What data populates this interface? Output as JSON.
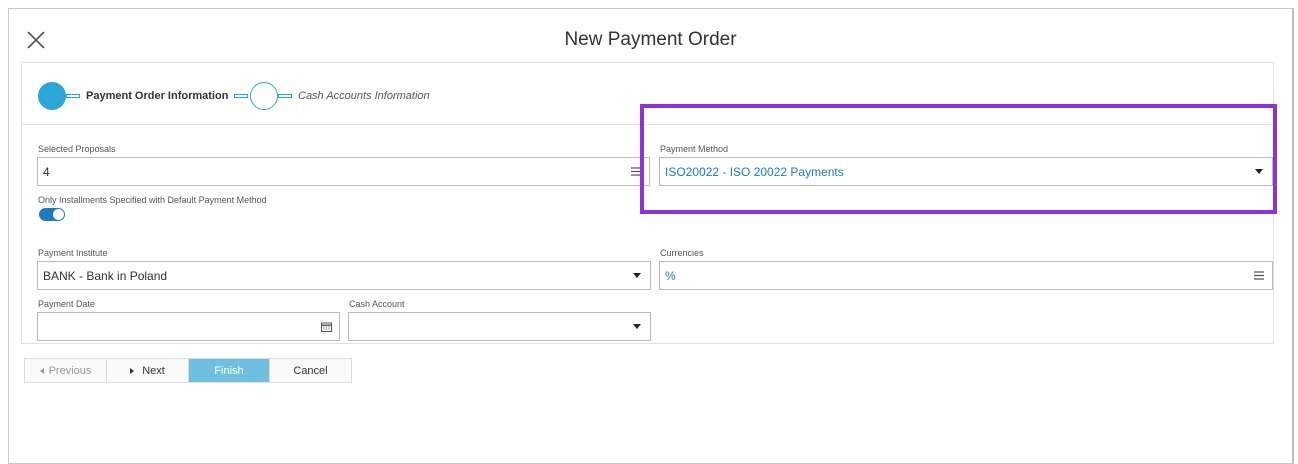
{
  "dialog": {
    "title": "New Payment Order"
  },
  "wizard": {
    "steps": [
      {
        "label": "Payment Order Information",
        "active": true
      },
      {
        "label": "Cash Accounts Information",
        "active": false
      }
    ]
  },
  "form": {
    "selected_proposals": {
      "label": "Selected Proposals",
      "value": "4"
    },
    "only_installments": {
      "label": "Only Installments Specified with Default Payment Method",
      "on": true
    },
    "payment_method": {
      "label": "Payment Method",
      "value": "ISO20022 - ISO 20022 Payments"
    },
    "payment_institute": {
      "label": "Payment Institute",
      "value": "BANK - Bank in Poland"
    },
    "currencies": {
      "label": "Currencies",
      "value": "%"
    },
    "payment_date": {
      "label": "Payment Date",
      "value": ""
    },
    "cash_account": {
      "label": "Cash Account",
      "value": ""
    }
  },
  "buttons": {
    "previous": "Previous",
    "next": "Next",
    "finish": "Finish",
    "cancel": "Cancel"
  },
  "colors": {
    "accent": "#2aa7d8",
    "link": "#1e7bbf",
    "highlight": "#8a33d9"
  }
}
